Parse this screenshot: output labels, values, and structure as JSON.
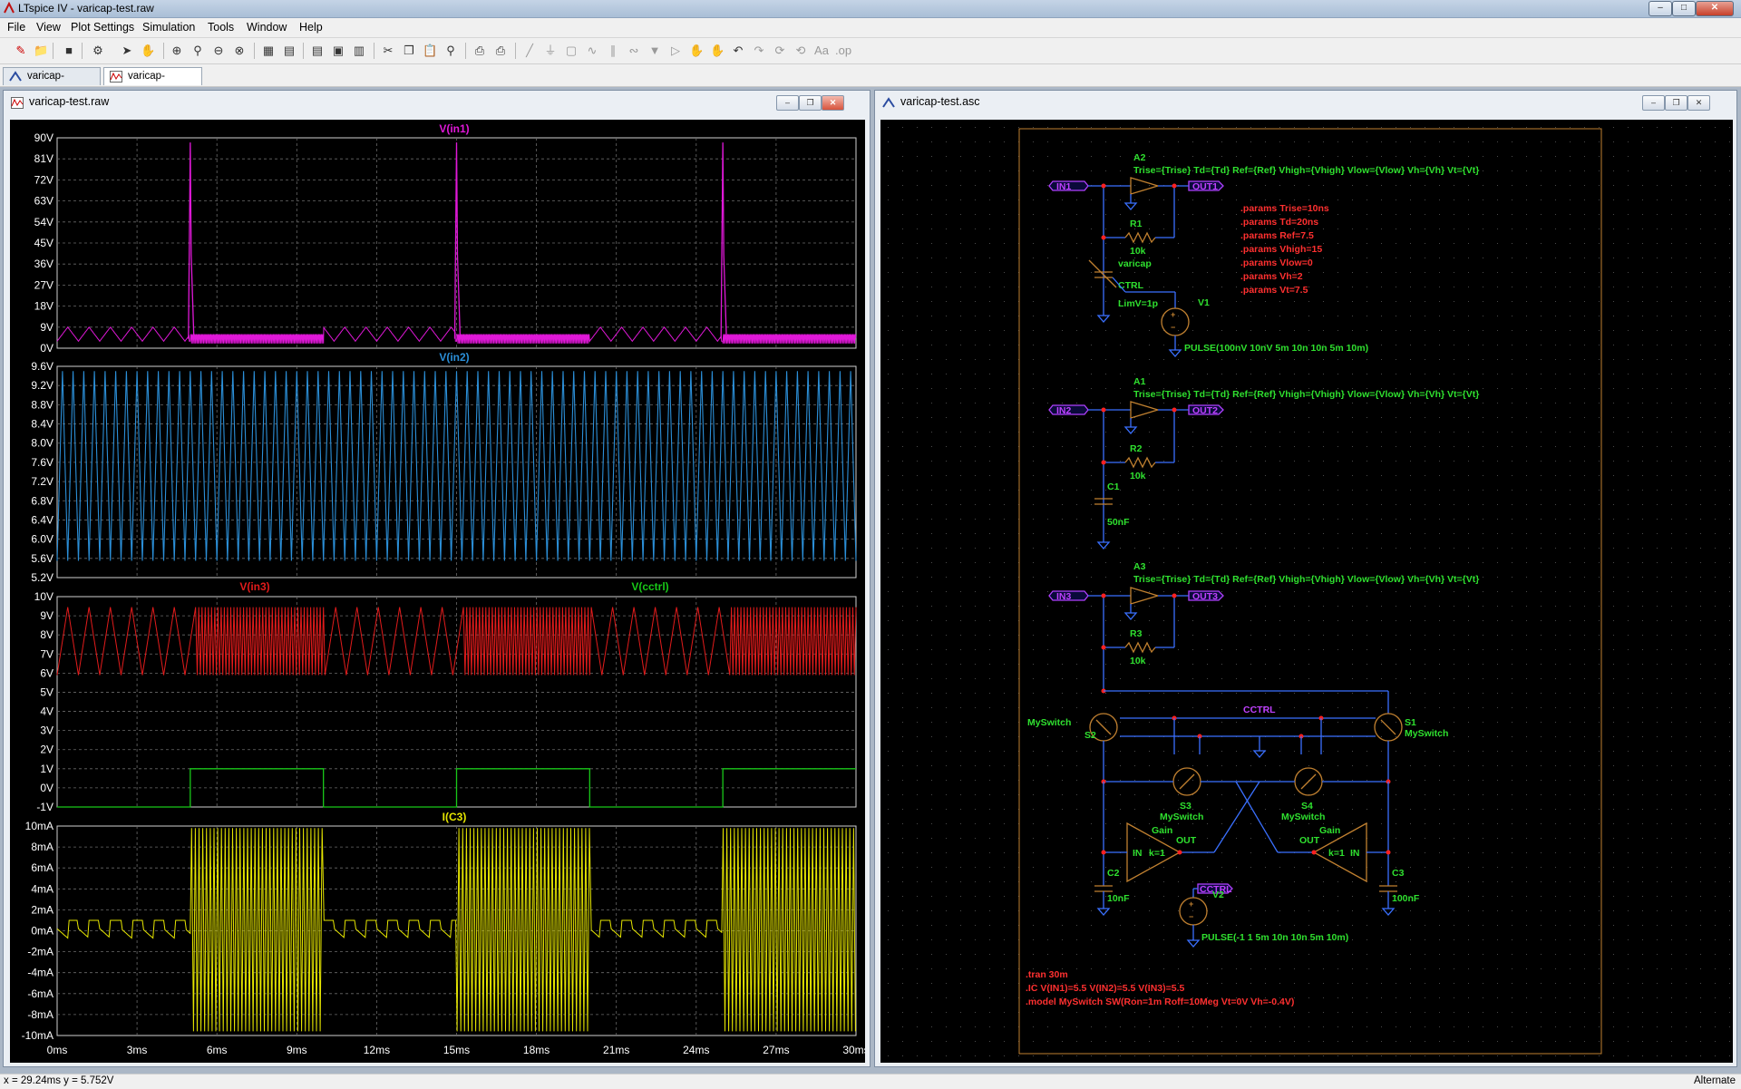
{
  "window": {
    "title": "LTspice IV - varicap-test.raw"
  },
  "menu": [
    "File",
    "View",
    "Plot Settings",
    "Simulation",
    "Tools",
    "Window",
    "Help"
  ],
  "tabs": [
    {
      "label": "varicap-test.asc",
      "active": false
    },
    {
      "label": "varicap-test.raw",
      "active": true
    }
  ],
  "waveform_window": {
    "title": "varicap-test.raw"
  },
  "schematic_window": {
    "title": "varicap-test.asc"
  },
  "status": {
    "coords": "x = 29.24ms   y = 5.752V",
    "mode": "Alternate"
  },
  "colors": {
    "in1": "#e018d8",
    "in2": "#2b8fd8",
    "in3": "#e21b1b",
    "cctrl": "#18c818",
    "c3": "#e6e600",
    "grid": "#6a6a6a",
    "axis": "#ffffff"
  },
  "chart_data": [
    {
      "type": "line",
      "title": "V(in1)",
      "series": [
        {
          "name": "V(in1)"
        }
      ],
      "ylim": [
        0,
        90
      ],
      "yticks": [
        "90V",
        "81V",
        "72V",
        "63V",
        "54V",
        "45V",
        "36V",
        "27V",
        "18V",
        "9V",
        "0V"
      ],
      "x": [
        0,
        30
      ],
      "xunit": "ms",
      "description": "sawtooth 3-9V, spikes to ~88V at 5ms, 15ms, 25ms, then fast ripple 2-6V during 5-10ms, 15-20ms, 25-30ms"
    },
    {
      "type": "line",
      "title": "V(in2)",
      "series": [
        {
          "name": "V(in2)"
        }
      ],
      "ylim": [
        5.2,
        9.6
      ],
      "yticks": [
        "9.6V",
        "9.2V",
        "8.8V",
        "8.4V",
        "8.0V",
        "7.6V",
        "7.2V",
        "6.8V",
        "6.4V",
        "6.0V",
        "5.6V",
        "5.2V"
      ],
      "x": [
        0,
        30
      ],
      "xunit": "ms"
    },
    {
      "type": "line",
      "title": "V(in3) / V(cctrl)",
      "series": [
        {
          "name": "V(in3)"
        },
        {
          "name": "V(cctrl)"
        }
      ],
      "ylim": [
        -1,
        10
      ],
      "yticks": [
        "10V",
        "9V",
        "8V",
        "7V",
        "6V",
        "5V",
        "4V",
        "3V",
        "2V",
        "1V",
        "0V",
        "-1V"
      ],
      "x": [
        0,
        30
      ],
      "xunit": "ms",
      "cctrl_pulses": [
        [
          5,
          10
        ],
        [
          15,
          20
        ],
        [
          25,
          30
        ]
      ]
    },
    {
      "type": "line",
      "title": "I(C3)",
      "series": [
        {
          "name": "I(C3)"
        }
      ],
      "ylim": [
        -10,
        10
      ],
      "yticks": [
        "10mA",
        "8mA",
        "6mA",
        "4mA",
        "2mA",
        "0mA",
        "-2mA",
        "-4mA",
        "-6mA",
        "-8mA",
        "-10mA"
      ],
      "x": [
        0,
        30
      ],
      "xunit": "ms",
      "xticks": [
        "0ms",
        "3ms",
        "6ms",
        "9ms",
        "12ms",
        "15ms",
        "18ms",
        "21ms",
        "24ms",
        "27ms",
        "30ms"
      ]
    }
  ],
  "schematic": {
    "A2": "A2",
    "A1": "A1",
    "A3": "A3",
    "trise_line": "Trise={Trise} Td={Td} Ref={Ref} Vhigh={Vhigh} Vlow={Vlow} Vh={Vh} Vt={Vt}",
    "params": [
      ".params Trise=10ns",
      ".params Td=20ns",
      ".params Ref=7.5",
      ".params Vhigh=15",
      ".params Vlow=0",
      ".params Vh=2",
      ".params Vt=7.5"
    ],
    "IN1": "IN1",
    "OUT1": "OUT1",
    "IN2": "IN2",
    "OUT2": "OUT2",
    "IN3": "IN3",
    "OUT3": "OUT3",
    "R1": "R1",
    "R2": "R2",
    "R3": "R3",
    "R1v": "10k",
    "R2v": "10k",
    "R3v": "10k",
    "varicap": "varicap",
    "CTRL": "CTRL",
    "LimV": "LimV=1p",
    "V1": "V1",
    "V1pulse": "PULSE(100nV 10nV 5m 10n 10n 5m 10m)",
    "C1": "C1",
    "C1v": "50nF",
    "CCTRL": "CCTRL",
    "S1": "S1",
    "S2": "S2",
    "S3": "S3",
    "S4": "S4",
    "MySwitch": "MySwitch",
    "Gain": "Gain",
    "k1": "k=1",
    "IN": "IN",
    "OUT": "OUT",
    "C2": "C2",
    "C2v": "10nF",
    "C3": "C3",
    "C3v": "100nF",
    "V2": "V2",
    "V2pulse": "PULSE(-1 1 5m 10n 10n 5m 10m)",
    "directives": [
      ".tran 30m",
      ".IC V(IN1)=5.5 V(IN2)=5.5 V(IN3)=5.5",
      ".model MySwitch SW(Ron=1m Roff=10Meg Vt=0V Vh=-0.4V)"
    ]
  }
}
